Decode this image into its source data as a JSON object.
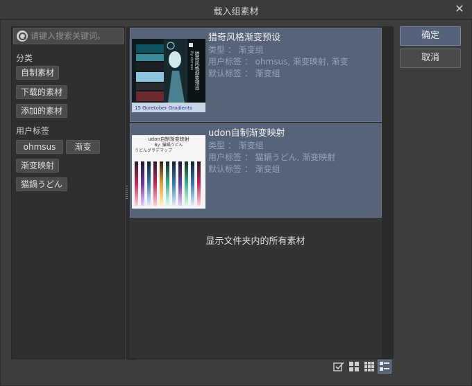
{
  "window": {
    "title": "载入组素材",
    "close_label": "✕"
  },
  "search": {
    "placeholder": "请键入搜索关键词。"
  },
  "sidebar": {
    "category_heading": "分类",
    "categories": [
      "自制素材",
      "下载的素材",
      "添加的素材"
    ],
    "user_tag_heading": "用户标签",
    "tags": [
      "ohmsus",
      "渐变",
      "渐变映射",
      "猫鍋うどん"
    ]
  },
  "items": [
    {
      "name": "猎奇风格渐变预设",
      "type_line": "类型 ： 渐变组",
      "user_tags_line": "用户标签 ： ohmsus, 渐变映射, 渐变",
      "default_tags_line": "默认标签 ： 渐变组",
      "thumb_caption": "15 Goretober Gradients",
      "thumb_title": "猎奇风格渐变预设",
      "thumb_by": "By:ohmsus"
    },
    {
      "name": "udon自制渐变映射",
      "type_line": "类型 ： 渐变组",
      "user_tags_line": "用户标签 ： 猫鍋うどん, 渐变映射",
      "default_tags_line": "默认标签 ： 渐变组",
      "thumb_title": "udon自制渐变映射",
      "thumb_by": "By: 猫鍋うどん",
      "thumb_sub": "うどんグラデマップ"
    }
  ],
  "info_text": "显示文件夹内的所有素材",
  "buttons": {
    "ok": "确定",
    "cancel": "取消"
  },
  "view_modes": [
    "checkbox-view",
    "large-grid-view",
    "small-grid-view",
    "detail-list-view"
  ],
  "colors": {
    "selection": "#566379",
    "background": "#3d3d3d"
  }
}
